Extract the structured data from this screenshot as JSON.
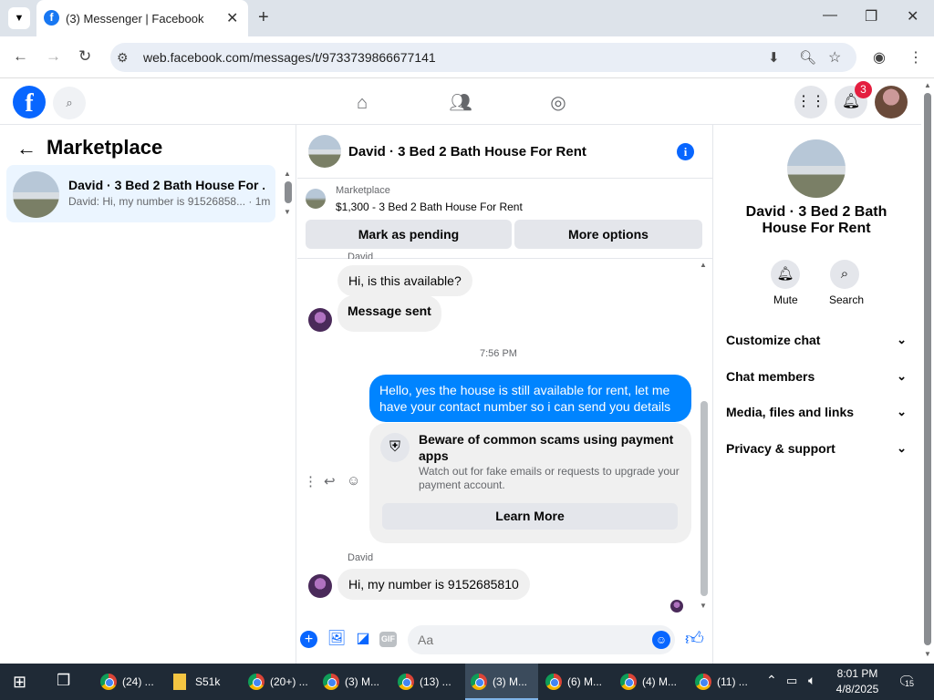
{
  "browser": {
    "tab_title": "(3) Messenger | Facebook",
    "url": "web.facebook.com/messages/t/9733739866677141"
  },
  "fb_header": {
    "notification_count": "3"
  },
  "left_panel": {
    "title": "Marketplace",
    "conversation": {
      "name": "David · 3 Bed 2 Bath House For ...",
      "snippet": "David: Hi, my number is 91526858... · 1m"
    }
  },
  "chat": {
    "title": "David · 3 Bed 2 Bath House For Rent",
    "listing_source": "Marketplace",
    "listing_price": "$1,300 - 3 Bed 2 Bath House For Rent",
    "mark_pending_label": "Mark as pending",
    "more_options_label": "More options",
    "messages": {
      "sender_top": "David",
      "msg1": "Hi, is this available?",
      "msg2": "Message sent",
      "timestamp": "7:56 PM",
      "outgoing": "Hello, yes the house is still available for rent, let me have your contact number so i can send you  details",
      "sender_bottom": "David",
      "msg3": "Hi, my number is 9152685810"
    },
    "scam_notice": {
      "title": "Beware of common scams using payment apps",
      "description": "Watch out for fake emails or requests to upgrade your payment account.",
      "learn_more": "Learn More"
    },
    "composer": {
      "placeholder": "Aa",
      "gif_label": "GIF"
    }
  },
  "right_panel": {
    "name": "David · 3 Bed 2 Bath House For Rent",
    "mute_label": "Mute",
    "search_label": "Search",
    "sections": [
      "Customize chat",
      "Chat members",
      "Media, files and links",
      "Privacy & support"
    ]
  },
  "taskbar": {
    "items": [
      "(24) ...",
      "S51k",
      "(20+) ...",
      "(3) M...",
      "(13) ...",
      "(3) M...",
      "(6) M...",
      "(4) M...",
      "(11) ..."
    ],
    "time": "8:01 PM",
    "date": "4/8/2025",
    "notification_count": "15"
  },
  "colors": {
    "accent": "#0866ff",
    "outgoing_bubble": "#0084ff",
    "taskbar": "#1f2a36"
  }
}
